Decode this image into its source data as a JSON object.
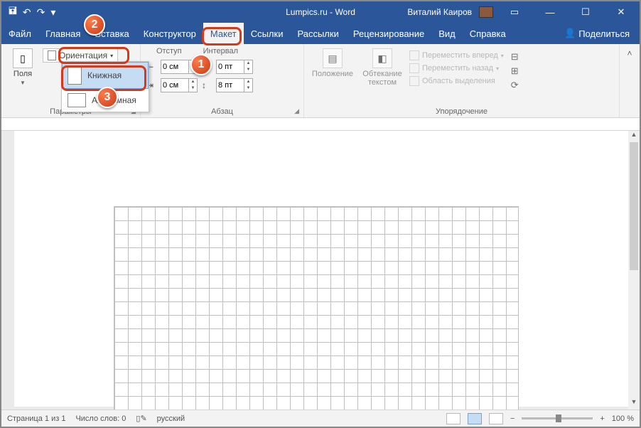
{
  "title": "Lumpics.ru - Word",
  "user": "Виталий Каиров",
  "tabs": {
    "file": "Файл",
    "home": "Главная",
    "insert": "Вставка",
    "design": "Конструктор",
    "layout": "Макет",
    "references": "Ссылки",
    "mailings": "Рассылки",
    "review": "Рецензирование",
    "view": "Вид",
    "help": "Справка"
  },
  "share": "Поделиться",
  "ribbon": {
    "margins": "Поля",
    "orientation": "Ориентация",
    "page_setup_group": "Параметры",
    "indent_header": "Отступ",
    "spacing_header": "Интервал",
    "indent_left": "0 см",
    "indent_right": "0 см",
    "spacing_before": "0 пт",
    "spacing_after": "8 пт",
    "paragraph_group": "Абзац",
    "position": "Положение",
    "wrap": "Обтекание текстом",
    "move_forward": "Переместить вперед",
    "move_back": "Переместить назад",
    "selection_pane": "Область выделения",
    "arrange_group": "Упорядочение"
  },
  "dropdown": {
    "portrait": "Книжная",
    "landscape": "Альбомная"
  },
  "status": {
    "page": "Страница 1 из 1",
    "words": "Число слов: 0",
    "lang": "русский",
    "zoom": "100 %"
  },
  "badges": {
    "b1": "1",
    "b2": "2",
    "b3": "3"
  }
}
